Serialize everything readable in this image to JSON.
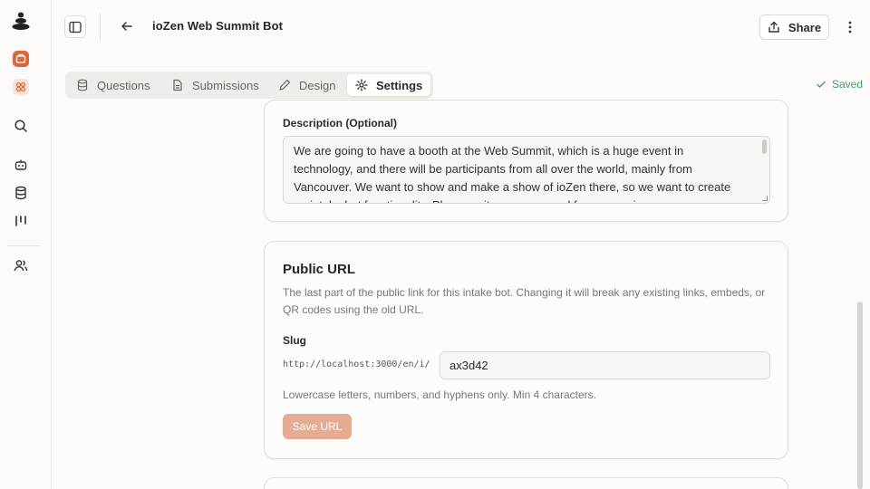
{
  "header": {
    "title": "ioZen Web Summit Bot",
    "share_label": "Share"
  },
  "tabs": [
    {
      "label": "Questions",
      "icon": "database-icon"
    },
    {
      "label": "Submissions",
      "icon": "file-icon"
    },
    {
      "label": "Design",
      "icon": "pencil-icon"
    },
    {
      "label": "Settings",
      "icon": "gear-icon",
      "active": true
    }
  ],
  "status": {
    "saved_label": "Saved",
    "color": "#3fa35f"
  },
  "description_card": {
    "label": "Description (Optional)",
    "value": "We are going to have a booth at the Web Summit, which is a huge event in technology, and there will be participants from all over the world, mainly from Vancouver. We want to show and make a show of ioZen there, so we want to create an intake bot functionality. Please write us a proposal for our services."
  },
  "public_url_card": {
    "title": "Public URL",
    "description": "The last part of the public link for this intake bot. Changing it will break any existing links, embeds, or QR codes using the old URL.",
    "slug_label": "Slug",
    "prefix": "http://localhost:3000/en/i/",
    "slug_value": "ax3d42",
    "hint": "Lowercase letters, numbers, and hyphens only. Min 4 characters.",
    "save_label": "Save URL"
  },
  "colors": {
    "accent": "#e5ac93",
    "brand_orange": "#d9673a"
  }
}
